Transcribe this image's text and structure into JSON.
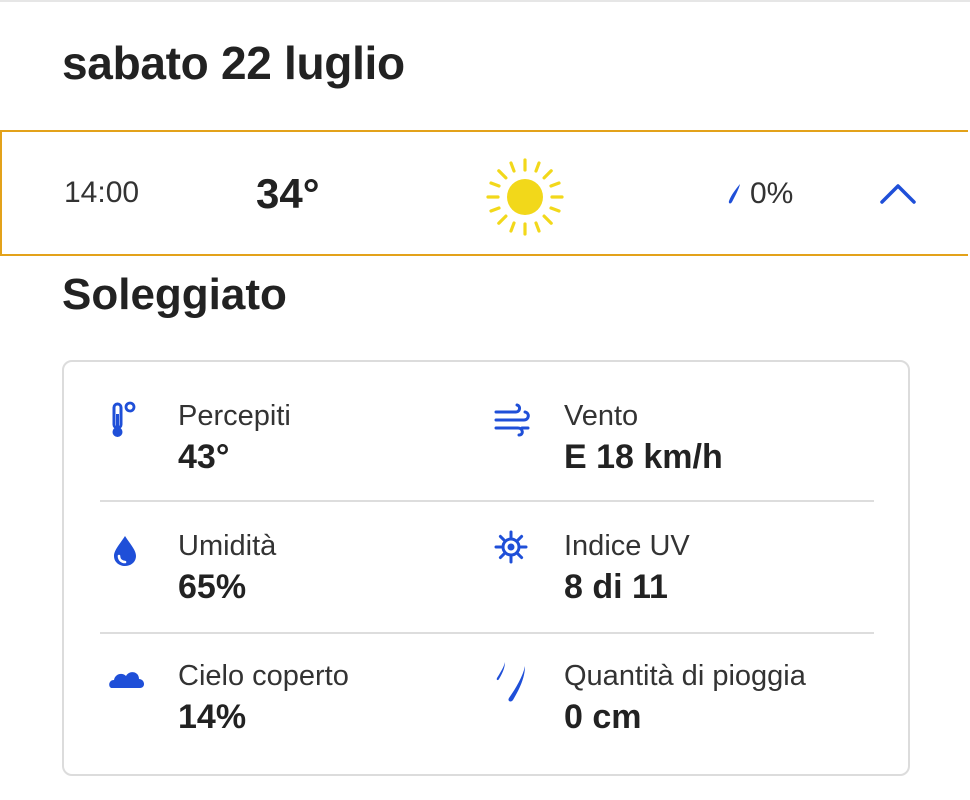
{
  "header": {
    "date": "sabato 22 luglio"
  },
  "hour": {
    "time": "14:00",
    "temperature": "34°",
    "weather_icon": "sun-icon",
    "precip_icon": "raindrop-icon",
    "precip_chance": "0%",
    "toggle_icon": "chevron-up-icon"
  },
  "condition": "Soleggiato",
  "details": {
    "feels_like": {
      "label": "Percepiti",
      "value": "43°",
      "icon": "thermometer-icon"
    },
    "wind": {
      "label": "Vento",
      "value": "E 18 km/h",
      "icon": "wind-icon"
    },
    "humidity": {
      "label": "Umidità",
      "value": "65%",
      "icon": "drop-icon"
    },
    "uv": {
      "label": "Indice UV",
      "value": "8 di 11",
      "icon": "uv-sun-icon"
    },
    "cloud": {
      "label": "Cielo coperto",
      "value": "14%",
      "icon": "cloud-icon"
    },
    "rain": {
      "label": "Quantità di pioggia",
      "value": "0 cm",
      "icon": "rain-icon"
    }
  },
  "colors": {
    "accent_blue": "#1f4fd8",
    "highlight_border": "#e3a21a",
    "sun_yellow": "#f2d81a"
  }
}
